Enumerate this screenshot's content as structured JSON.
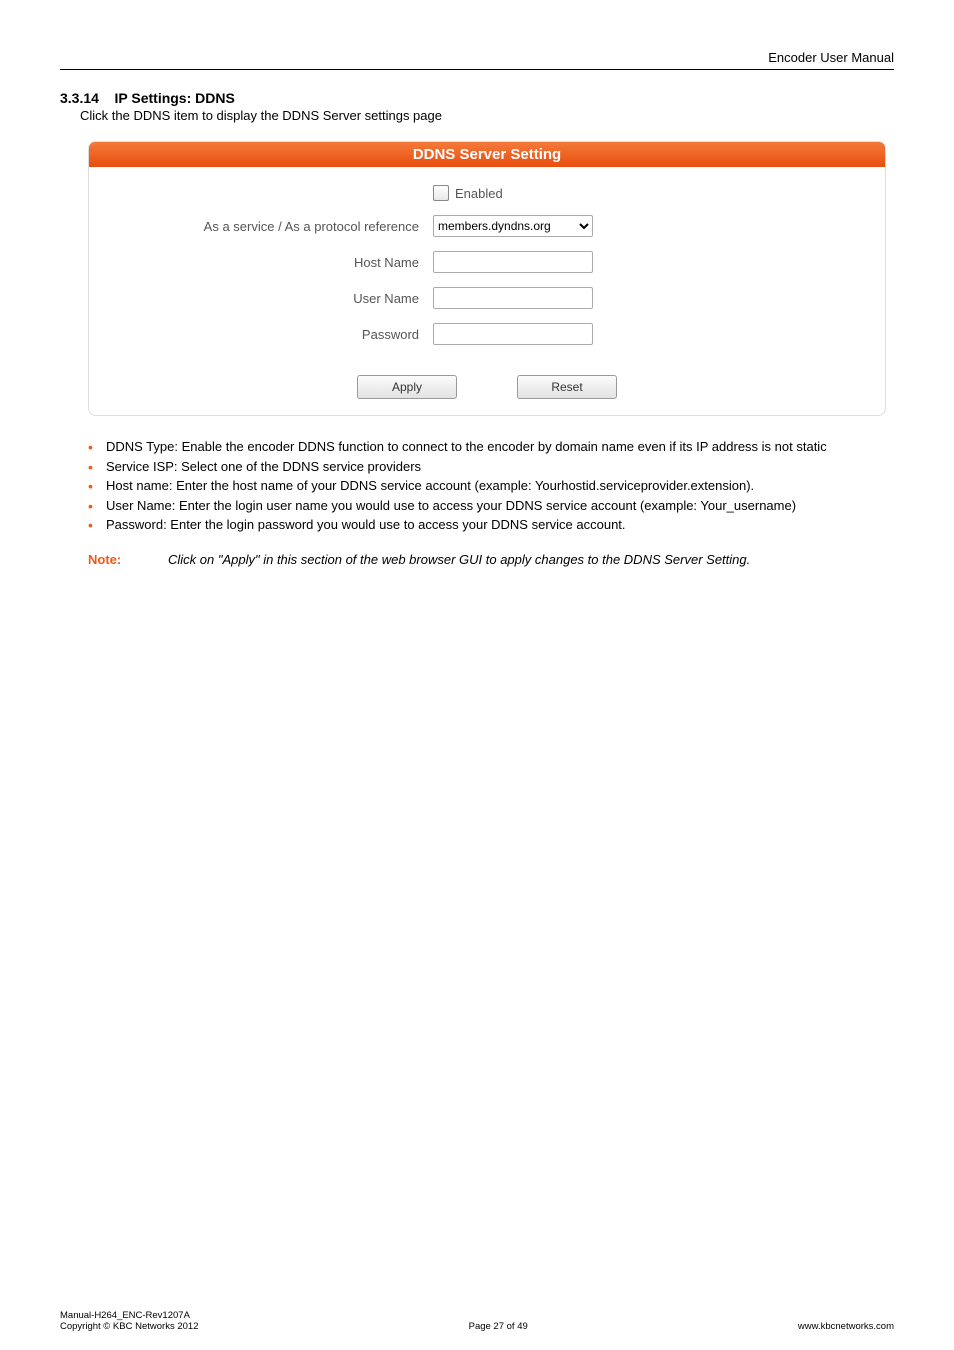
{
  "header": {
    "title": "Encoder User Manual"
  },
  "section": {
    "number": "3.3.14",
    "title": "IP Settings: DDNS",
    "subtitle": "Click the DDNS item to display the DDNS Server settings page"
  },
  "panel": {
    "title": "DDNS Server Setting",
    "enabled_label": "Enabled",
    "service_label": "As a service / As a protocol reference",
    "service_value": "members.dyndns.org",
    "hostname_label": "Host Name",
    "hostname_value": "",
    "username_label": "User Name",
    "username_value": "",
    "password_label": "Password",
    "password_value": "",
    "apply_label": "Apply",
    "reset_label": "Reset"
  },
  "bullets": [
    "DDNS Type: Enable the encoder DDNS function to connect to the encoder by domain name even if its IP address is not static",
    "Service ISP: Select one of the DDNS service providers",
    "Host name: Enter the host name of your DDNS service account (example: Yourhostid.serviceprovider.extension).",
    "User Name: Enter the login user name you would use to access your DDNS service account (example: Your_username)",
    "Password: Enter the login password you would use to access your DDNS service account."
  ],
  "note": {
    "label": "Note:",
    "text": "Click on \"Apply\" in this section of the web browser GUI to apply changes to the DDNS Server Setting."
  },
  "footer": {
    "left_line1": "Manual-H264_ENC-Rev1207A",
    "left_line2": "Copyright © KBC Networks 2012",
    "center": "Page 27 of 49",
    "right": "www.kbcnetworks.com"
  }
}
